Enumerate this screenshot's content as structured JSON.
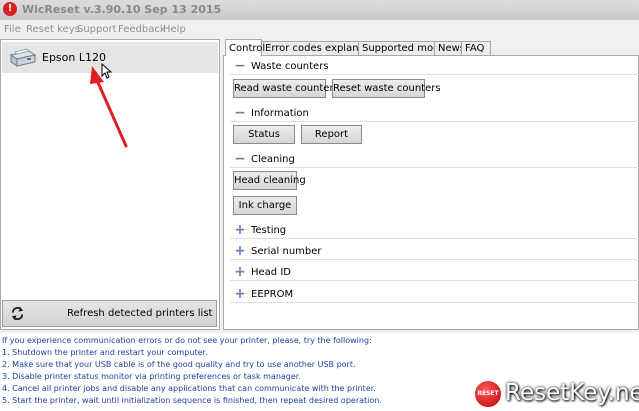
{
  "window": {
    "title": "WicReset v.3.90.10 Sep 13 2015",
    "icon": "!"
  },
  "menu": [
    "File",
    "Reset keys",
    "Support",
    "Feedback",
    "Help"
  ],
  "printers": [
    {
      "name": "Epson L120"
    }
  ],
  "refresh_button": "Refresh detected printers list",
  "tabs": [
    "Control",
    "Error codes explanation",
    "Supported models",
    "News",
    "FAQ"
  ],
  "sections": {
    "waste": {
      "label": "Waste counters",
      "buttons": [
        "Read waste counters",
        "Reset waste counters"
      ]
    },
    "information": {
      "label": "Information",
      "buttons": [
        "Status",
        "Report"
      ]
    },
    "cleaning": {
      "label": "Cleaning",
      "buttons": [
        "Head cleaning",
        "Ink charge"
      ]
    },
    "collapsed": [
      "Testing",
      "Serial number",
      "Head ID",
      "EEPROM"
    ]
  },
  "log": [
    "If you experience communication errors or do not see your printer, please, try the following:",
    "1. Shutdown the printer and restart your computer.",
    "2. Make sure that your USB cable is of the good quality and try to use another USB port.",
    "3. Disable printer status monitor via printing preferences or task manager.",
    "4. Cancel all printer jobs and disable any applications that can communicate with the printer.",
    "5. Start the printer, wait until initialization sequence is finished, then repeat desired operation."
  ],
  "watermark": {
    "badge": "RESET",
    "text": "ResetKey.net"
  },
  "colors": {
    "accent": "#5b84c4",
    "log_text": "#1f3fa0",
    "annotation": "#e02020"
  }
}
